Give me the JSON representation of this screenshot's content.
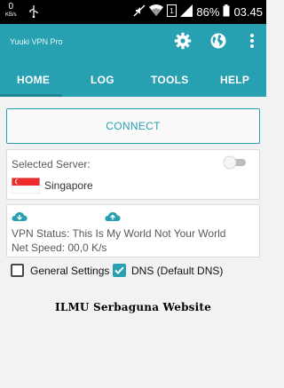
{
  "status_bar": {
    "net_speed_value": "0",
    "net_speed_unit": "KB/s",
    "battery": "86%",
    "time": "03.45"
  },
  "app_bar": {
    "title": "Yuuki VPN Pro",
    "icons": [
      "settings-gear",
      "globe",
      "more-vertical"
    ]
  },
  "tabs": [
    {
      "label": "HOME",
      "selected": true
    },
    {
      "label": "LOG",
      "selected": false
    },
    {
      "label": "TOOLS",
      "selected": false
    },
    {
      "label": "HELP",
      "selected": false
    }
  ],
  "connect_button": {
    "label": "CONNECT"
  },
  "server": {
    "label": "Selected Server:",
    "name": "Singapore",
    "toggle_on": false
  },
  "status": {
    "vpn_status": "VPN Status:  This Is My World Not Your World",
    "net_speed": "Net Speed:  00,0 K/s"
  },
  "settings": {
    "general_label": "General Settings",
    "general_checked": false,
    "dns_label": "DNS (Default DNS)",
    "dns_checked": true
  },
  "watermark": "ILMU Serbaguna Website",
  "colors": {
    "accent": "#27a0b2",
    "background": "#f2f2f2"
  }
}
